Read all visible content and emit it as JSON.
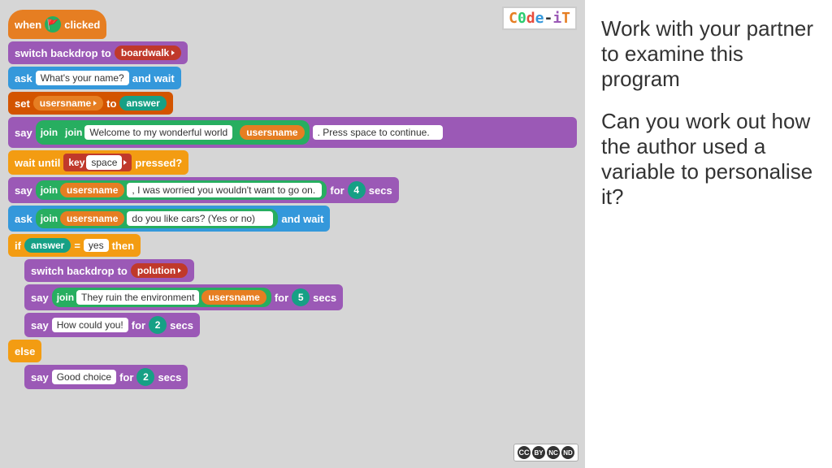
{
  "logo": {
    "text": "Code-iT",
    "display": "C0de-iT"
  },
  "right": {
    "paragraph1": "Work with your partner to examine this program",
    "paragraph2": "Can you work out how the author used a variable to personalise it?"
  },
  "blocks": {
    "when_clicked": "when",
    "clicked": "clicked",
    "switch_backdrop": "switch backdrop",
    "to_label": "to",
    "boardwalk": "boardwalk",
    "ask_label": "ask",
    "ask_input": "What's your name?",
    "and_wait": "and wait",
    "set_label": "set",
    "usersname": "usersname",
    "to_label2": "to",
    "answer": "answer",
    "say_label": "say",
    "join_label": "join",
    "welcome_text": "Welcome to my wonderful world",
    "press_space": ". Press space to continue.",
    "wait_until": "wait until",
    "key_label": "key",
    "space_label": "space",
    "pressed": "pressed?",
    "worried_text": ", I was worried you wouldn't want to go on.",
    "for_label": "for",
    "secs_label": "secs",
    "ask_join_label": "ask",
    "do_you_like": "do you like cars? (Yes or no)",
    "if_label": "if",
    "equals_label": "=",
    "yes_val": "yes",
    "then_label": "then",
    "switch_backdrop2": "switch backdrop",
    "to_label3": "to",
    "polution": "polution",
    "they_ruin": "They ruin the environment",
    "how_could_you": "How could you!",
    "else_label": "else",
    "good_choice": "Good choice",
    "num4": "4",
    "num5": "5",
    "num2a": "2",
    "num2b": "2"
  }
}
